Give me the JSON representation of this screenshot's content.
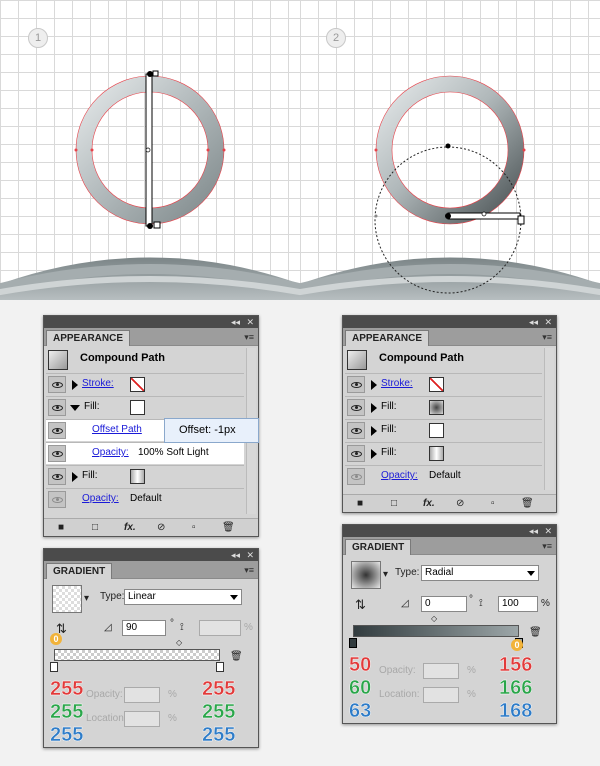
{
  "steps": {
    "step1": "1",
    "step2": "2"
  },
  "appearance1": {
    "tab": "APPEARANCE",
    "header": "Compound Path",
    "stroke_label": "Stroke:",
    "fill_label": "Fill:",
    "offset_path_label": "Offset Path",
    "opacity_label": "Opacity:",
    "opacity_value": "100% Soft Light",
    "fill2_label": "Fill:",
    "opacity2_label": "Opacity:",
    "opacity2_value": "Default",
    "tooltip": "Offset: -1px"
  },
  "gradient1": {
    "tab": "GRADIENT",
    "type_label": "Type:",
    "type_value": "Linear",
    "angle_value": "90",
    "percent_sign": "%",
    "rgb_left": [
      "255",
      "255",
      "255"
    ],
    "rgb_right": [
      "255",
      "255",
      "255"
    ],
    "opacity_label": "Opacity:",
    "location_label": "Location:",
    "stop_marker": "0"
  },
  "appearance2": {
    "tab": "APPEARANCE",
    "header": "Compound Path",
    "stroke_label": "Stroke:",
    "fill_label": "Fill:",
    "fill2_label": "Fill:",
    "fill3_label": "Fill:",
    "opacity_label": "Opacity:",
    "opacity_value": "Default"
  },
  "gradient2": {
    "tab": "GRADIENT",
    "type_label": "Type:",
    "type_value": "Radial",
    "angle_value": "0",
    "aspect_value": "100",
    "percent_sign": "%",
    "rgb_left": [
      "50",
      "60",
      "63"
    ],
    "rgb_right": [
      "156",
      "166",
      "168"
    ],
    "opacity_label": "Opacity:",
    "location_label": "Location:",
    "stop_marker": "0"
  },
  "icons": [
    "visibility-eye-icon",
    "expand-triangle-icon",
    "fx-icon",
    "clear-icon",
    "duplicate-icon",
    "trash-icon",
    "panel-menu-icon",
    "angle-icon",
    "aspect-ratio-icon",
    "reverse-gradient-icon"
  ],
  "colors": {
    "ring_light": "#d6dcdd",
    "ring_dark": "#8a9496",
    "anchor_red": "#e8424a",
    "panel": "#d4d4d4",
    "blue_link": "#1a1ad8"
  }
}
